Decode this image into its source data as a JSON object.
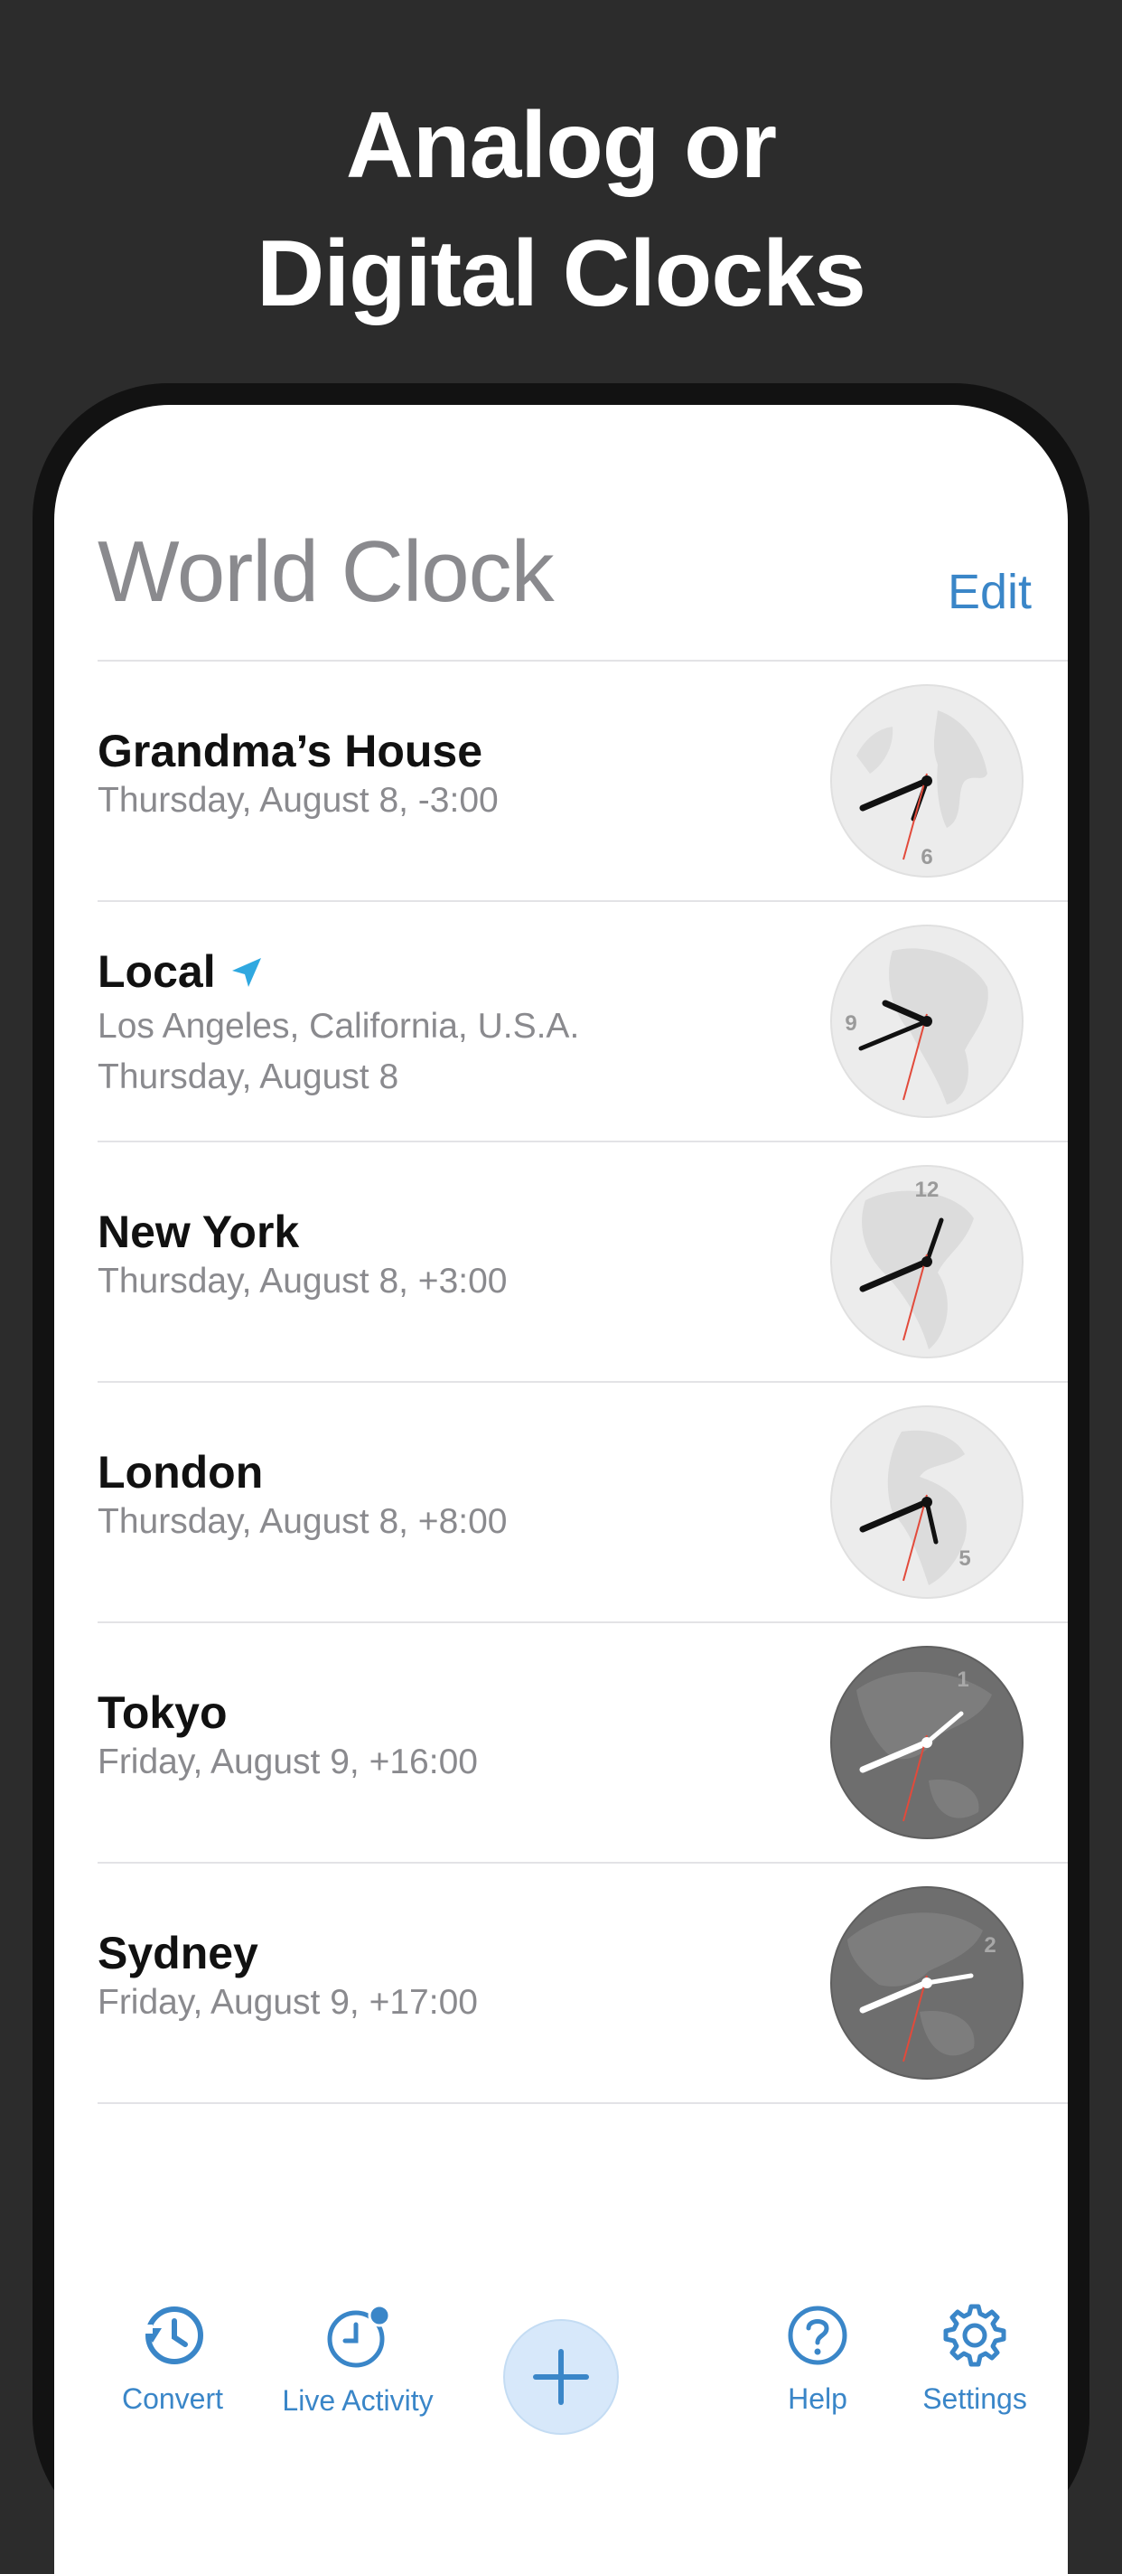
{
  "headline": {
    "line1": "Analog or",
    "line2": "Digital Clocks"
  },
  "nav": {
    "title": "World Clock",
    "edit_label": "Edit"
  },
  "clocks": [
    {
      "name": "Grandma’s House",
      "lines": [
        "Thursday, August 8, -3:00"
      ],
      "numeral": "6",
      "theme": "light"
    },
    {
      "name": "Local",
      "lines": [
        "Los Angeles, California, U.S.A.",
        "Thursday, August 8"
      ],
      "numeral": "9",
      "theme": "light",
      "location_icon": "location-arrow-icon"
    },
    {
      "name": "New York",
      "lines": [
        "Thursday, August 8, +3:00"
      ],
      "numeral": "12",
      "theme": "light"
    },
    {
      "name": "London",
      "lines": [
        "Thursday, August 8, +8:00"
      ],
      "numeral": "5",
      "theme": "light"
    },
    {
      "name": "Tokyo",
      "lines": [
        "Friday, August 9, +16:00"
      ],
      "numeral": "1",
      "theme": "dark"
    },
    {
      "name": "Sydney",
      "lines": [
        "Friday, August 9, +17:00"
      ],
      "numeral": "2",
      "theme": "dark"
    }
  ],
  "tabbar": {
    "convert": "Convert",
    "live_activity": "Live Activity",
    "add": "add-icon",
    "help": "Help",
    "settings": "Settings"
  },
  "colors": {
    "background": "#2c2c2c",
    "accent": "#3a86c8",
    "location_arrow": "#2fa8e0",
    "second_hand": "#e24a3b"
  }
}
